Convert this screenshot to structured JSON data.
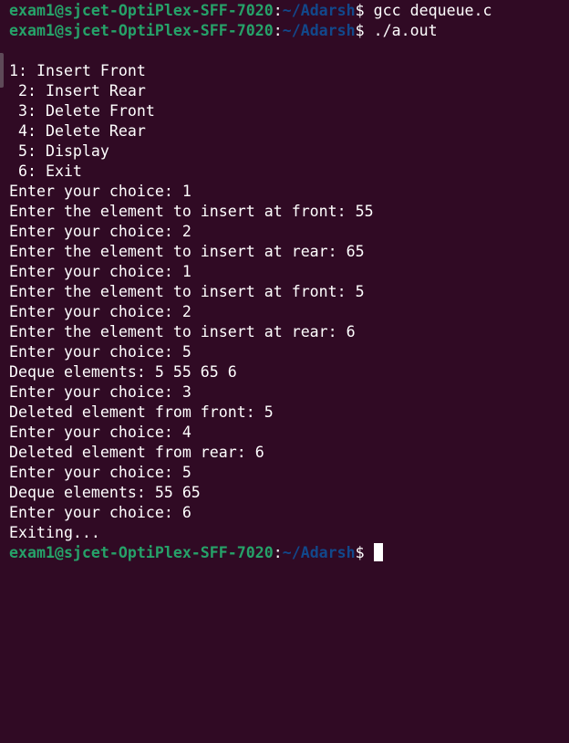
{
  "terminal": {
    "prompt": {
      "user_host": "exam1@sjcet-OptiPlex-SFF-7020",
      "colon": ":",
      "path": "~/Adarsh",
      "dollar": "$"
    },
    "commands": [
      "gcc dequeue.c",
      "./a.out"
    ],
    "output": [
      "1: Insert Front",
      " 2: Insert Rear",
      " 3: Delete Front",
      " 4: Delete Rear",
      " 5: Display",
      " 6: Exit",
      "Enter your choice: 1",
      "Enter the element to insert at front: 55",
      "Enter your choice: 2",
      "Enter the element to insert at rear: 65",
      "Enter your choice: 1",
      "Enter the element to insert at front: 5",
      "Enter your choice: 2",
      "Enter the element to insert at rear: 6",
      "Enter your choice: 5",
      "Deque elements: 5 55 65 6",
      "Enter your choice: 3",
      "Deleted element from front: 5",
      "Enter your choice: 4",
      "Deleted element from rear: 6",
      "Enter your choice: 5",
      "Deque elements: 55 65",
      "Enter your choice: 6",
      "Exiting..."
    ]
  },
  "colors": {
    "background": "#300a24",
    "user_host": "#26a269",
    "path": "#12488b",
    "text": "#ffffff"
  },
  "icons": {
    "cursor": "block-cursor"
  }
}
